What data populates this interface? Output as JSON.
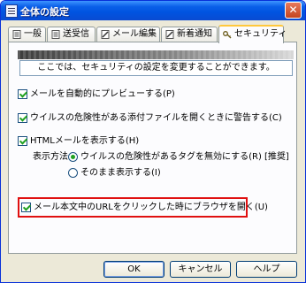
{
  "window": {
    "title": "全体の設定",
    "close_glyph": "✕"
  },
  "tabs": [
    {
      "label": "一般"
    },
    {
      "label": "送受信"
    },
    {
      "label": "メール編集"
    },
    {
      "label": "新着通知"
    },
    {
      "label": "セキュリティ"
    }
  ],
  "panel": {
    "info_text": "ここでは、セキュリティの設定を変更することができます。",
    "options": {
      "preview": {
        "label": "メールを自動的にプレビューする(P)",
        "checked": true
      },
      "attachment_warning": {
        "label": "ウイルスの危険性がある添付ファイルを開くときに警告する(C)",
        "checked": true
      },
      "html_display": {
        "label": "HTMLメールを表示する(H)",
        "checked": true
      },
      "display_method_label": "表示方法",
      "radio_disable_tags": {
        "label": "ウイルスの危険性があるタグを無効にする(R) [推奨]",
        "checked": true
      },
      "radio_as_is": {
        "label": "そのまま表示する(I)",
        "checked": false
      },
      "url_browser": {
        "label": "メール本文中のURLをクリックした時にブラウザを開く(U)",
        "checked": true
      }
    }
  },
  "buttons": {
    "ok": "OK",
    "cancel": "キャンセル",
    "help": "ヘルプ"
  },
  "colors": {
    "titlebar": "#0a5fe8",
    "highlight": "#e01010",
    "check": "#21a121"
  }
}
